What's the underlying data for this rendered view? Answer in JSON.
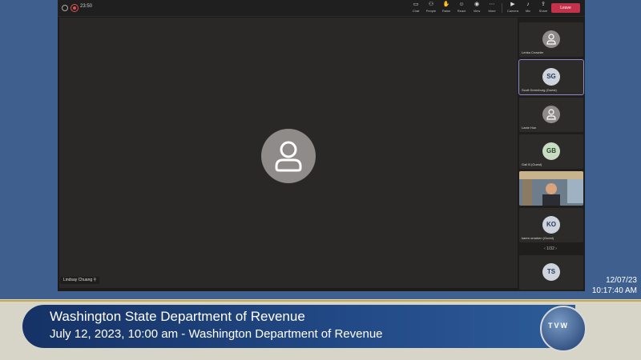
{
  "meeting": {
    "timer": "23:50",
    "toolbar": [
      {
        "label": "Chat",
        "icon": "chat-icon",
        "glyph": "▭"
      },
      {
        "label": "People",
        "icon": "people-icon",
        "glyph": "⚇"
      },
      {
        "label": "Raise",
        "icon": "raise-hand-icon",
        "glyph": "✋"
      },
      {
        "label": "React",
        "icon": "react-icon",
        "glyph": "☺"
      },
      {
        "label": "View",
        "icon": "view-icon",
        "glyph": "◉"
      },
      {
        "label": "More",
        "icon": "more-icon",
        "glyph": "⋯"
      },
      {
        "label": "Camera",
        "icon": "camera-icon",
        "glyph": "▶"
      },
      {
        "label": "Mic",
        "icon": "mic-icon",
        "glyph": "♪"
      },
      {
        "label": "Share",
        "icon": "share-icon",
        "glyph": "⇪"
      }
    ],
    "leave_label": "Leave",
    "speaker_name": "Lindsay Chuang",
    "participants": [
      {
        "name": "Lenka Crowder",
        "initials": "",
        "style": "gray"
      },
      {
        "name": "Scott Greenburg (Guest)",
        "initials": "SG",
        "style": "blue"
      },
      {
        "name": "Lanie Hun",
        "initials": "",
        "style": "gray"
      },
      {
        "name": "Gail B (Guest)",
        "initials": "GB",
        "style": "green"
      },
      {
        "name": "",
        "initials": "",
        "style": "video"
      },
      {
        "name": "karen omahen (Guest)",
        "initials": "KO",
        "style": "blue"
      },
      {
        "name": "",
        "initials": "TS",
        "style": "blue"
      }
    ],
    "pager": "1/32"
  },
  "broadcast": {
    "date": "12/07/23",
    "time": "10:17:40 AM",
    "title": "Washington State Department of Revenue",
    "subtitle": "July 12, 2023, 10:00 am - Washington Department of Revenue",
    "logo_text": "TVW"
  }
}
